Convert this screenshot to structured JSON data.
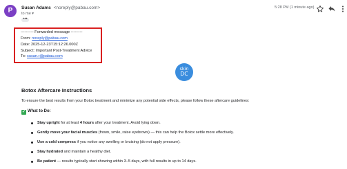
{
  "sender": {
    "avatar_letter": "P",
    "name": "Susan Adams",
    "email": "<noreply@pabau.com>",
    "to_label": "to me",
    "to_caret": "▾",
    "more": "•••"
  },
  "header": {
    "time": "5:28 PM (1 minute ago)",
    "star_icon": "star-icon",
    "reply_icon": "reply-icon",
    "more_icon": "more-vert-icon"
  },
  "forwarded": {
    "heading": "---------- Forwarded message ---------",
    "from_label": "From:",
    "from_value": "noreply@pabau.com",
    "date_label": "Date:",
    "date_value": "2025-12-23T15:12:26.000Z",
    "subject_label": "Subject:",
    "subject_value": "Important Post-Treatment Advice",
    "to_label": "To:",
    "to_value": "susan.r@pabau.com"
  },
  "logo": {
    "line1": "skin",
    "line2": "DC"
  },
  "body": {
    "title": "Botox Aftercare Instructions",
    "intro": "To ensure the best results from your Botox treatment and minimize any potential side effects, please follow these aftercare guidelines:",
    "todo_icon": "✓",
    "todo_heading": "What to Do:",
    "items": [
      {
        "bold": "Stay upright",
        "text": " for at least ",
        "bold2": "4 hours",
        "text2": " after your treatment. Avoid lying down."
      },
      {
        "bold": "Gently move your facial muscles",
        "text": " (frown, smile, raise eyebrows) — this can help the Botox settle more effectively.",
        "bold2": "",
        "text2": ""
      },
      {
        "bold": "Use a cold compress",
        "text": " if you notice any swelling or bruising (do not apply pressure).",
        "bold2": "",
        "text2": ""
      },
      {
        "bold": "Stay hydrated",
        "text": " and maintain a healthy diet.",
        "bold2": "",
        "text2": ""
      },
      {
        "bold": "Be patient",
        "text": " — results typically start showing within 3–5 days, with full results in up to 14 days.",
        "bold2": "",
        "text2": ""
      }
    ]
  }
}
